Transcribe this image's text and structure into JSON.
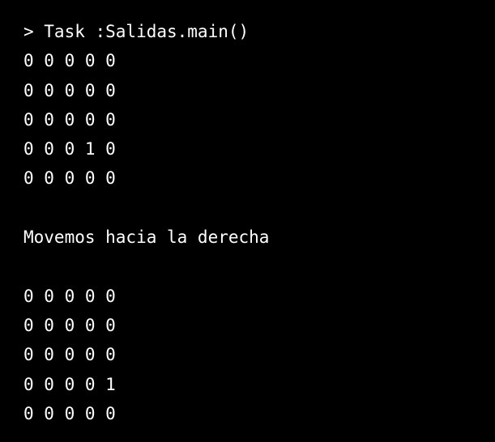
{
  "terminal": {
    "task_line": "> Task :Salidas.main()",
    "grid_before": [
      "0 0 0 0 0",
      "0 0 0 0 0",
      "0 0 0 0 0",
      "0 0 0 1 0",
      "0 0 0 0 0"
    ],
    "message": "Movemos hacia la derecha",
    "grid_after": [
      "0 0 0 0 0",
      "0 0 0 0 0",
      "0 0 0 0 0",
      "0 0 0 0 1",
      "0 0 0 0 0"
    ]
  }
}
